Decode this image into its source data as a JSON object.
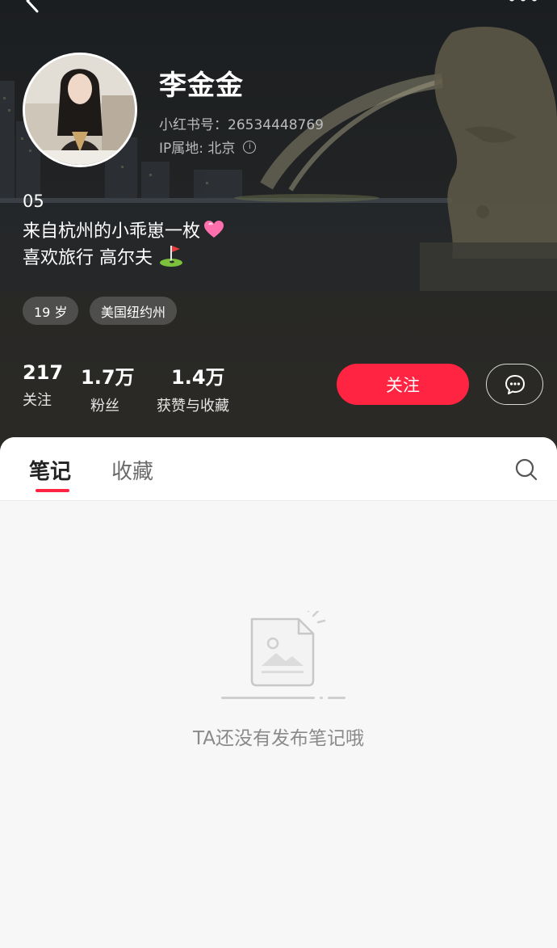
{
  "profile": {
    "name": "李金金",
    "red_id": "小红书号：26534448769",
    "ip_location": "IP属地: 北京",
    "bio_lines": [
      "05",
      "来自杭州的小乖崽一枚",
      "喜欢旅行 高尔夫"
    ],
    "tags": [
      "19 岁",
      "美国纽约州"
    ]
  },
  "stats": [
    {
      "value": "217",
      "label": "关注"
    },
    {
      "value": "1.7万",
      "label": "粉丝"
    },
    {
      "value": "1.4万",
      "label": "获赞与收藏"
    }
  ],
  "actions": {
    "follow_label": "关注"
  },
  "tabs": [
    {
      "label": "笔记",
      "active": true
    },
    {
      "label": "收藏",
      "active": false
    }
  ],
  "empty_state": {
    "message": "TA还没有发布笔记哦"
  },
  "icons": [
    "back-icon",
    "more-icon",
    "info-icon",
    "heart-icon",
    "golf-flag-icon",
    "message-icon",
    "search-icon",
    "empty-note-icon"
  ],
  "colors": {
    "accent": "#ff2442",
    "header_bg": "#23272a",
    "body_bg": "#f7f7f7"
  }
}
